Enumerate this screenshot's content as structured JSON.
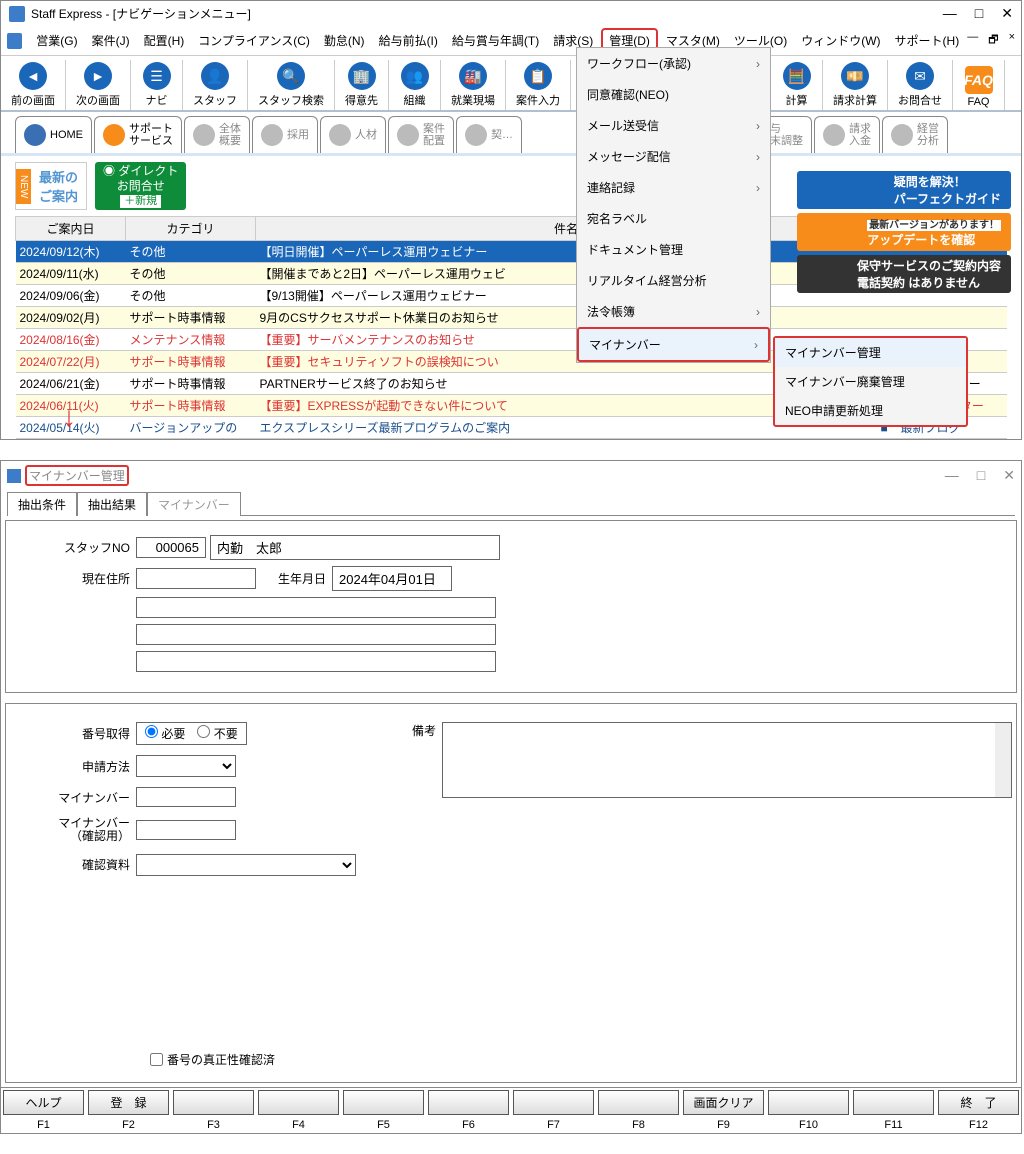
{
  "upper": {
    "title": "Staff Express - [ナビゲーションメニュー]",
    "menus": [
      "営業(G)",
      "案件(J)",
      "配置(H)",
      "コンプライアンス(C)",
      "勤怠(N)",
      "給与前払(I)",
      "給与賞与年調(T)",
      "請求(S)",
      "管理(D)",
      "マスタ(M)",
      "ツール(O)",
      "ウィンドウ(W)",
      "サポート(H)"
    ],
    "toolbar": [
      "前の画面",
      "次の画面",
      "ナビ",
      "スタッフ",
      "スタッフ検索",
      "得意先",
      "組織",
      "就業現場",
      "案件入力",
      "計算",
      "請求計算",
      "お問合せ",
      "FAQ"
    ],
    "dropdown": [
      "ワークフロー(承認)",
      "同意確認(NEO)",
      "メール送受信",
      "メッセージ配信",
      "連絡記録",
      "宛名ラベル",
      "ドキュメント管理",
      "リアルタイム経営分析",
      "法令帳簿",
      "マイナンバー"
    ],
    "submenu": [
      "マイナンバー管理",
      "マイナンバー廃棄管理",
      "NEO申請更新処理"
    ],
    "tabs": [
      {
        "l1": "HOME"
      },
      {
        "l1": "サポート",
        "l2": "サービス"
      },
      {
        "l1": "全体",
        "l2": "概要"
      },
      {
        "l1": "採用"
      },
      {
        "l1": "人材"
      },
      {
        "l1": "案件",
        "l2": "配置"
      },
      {
        "l1": "契…"
      },
      {
        "l1": "給与",
        "l2": "年末調整"
      },
      {
        "l1": "請求",
        "l2": "入金"
      },
      {
        "l1": "経営",
        "l2": "分析"
      }
    ],
    "banner_news": "最新の\nご案内",
    "banner_direct": {
      "t1": "ダイレクト",
      "t2": "お問合せ",
      "t3": "＋新規"
    },
    "sideb": [
      {
        "t1": "疑問を解決！",
        "t2": "パーフェクトガイド"
      },
      {
        "t1": "最新バージョンがあります！",
        "t2": "アップデートを確認"
      },
      {
        "t1": "保守サービスのご契約内容",
        "t2": "電話契約 はありません"
      }
    ],
    "table_head": [
      "ご案内日",
      "カテゴリ",
      "件名",
      "",
      ""
    ],
    "rows": [
      {
        "cls": "row-sel",
        "c": [
          "2024/09/12(木)",
          "その他",
          "【明日開催】ペーパーレス運用ウェビナー",
          "",
          ""
        ]
      },
      {
        "cls": "row-y",
        "c": [
          "2024/09/11(水)",
          "その他",
          "【開催まであと2日】ペーパーレス運用ウェビ",
          "",
          ""
        ]
      },
      {
        "cls": "",
        "c": [
          "2024/09/06(金)",
          "その他",
          "【9/13開催】ペーパーレス運用ウェビナー",
          "",
          ""
        ]
      },
      {
        "cls": "row-y",
        "c": [
          "2024/09/02(月)",
          "サポート時事情報",
          "9月のCSサクセスサポート休業日のお知らせ",
          "",
          ""
        ]
      },
      {
        "cls": "row-r",
        "c": [
          "2024/08/16(金)",
          "メンテナンス情報",
          "【重要】サーバメンテナンスのお知らせ",
          "",
          ""
        ]
      },
      {
        "cls": "row-r row-y",
        "c": [
          "2024/07/22(月)",
          "サポート時事情報",
          "【重要】セキュリティソフトの誤検知につい",
          "",
          ""
        ]
      },
      {
        "cls": "",
        "c": [
          "2024/06/21(金)",
          "サポート時事情報",
          "PARTNERサービス終了のお知らせ",
          "■",
          "PARTNERサー"
        ]
      },
      {
        "cls": "row-r row-y",
        "c": [
          "2024/06/11(火)",
          "サポート時事情報",
          "【重要】EXPRESSが起動できない件について",
          "",
          "ニュースレター"
        ]
      },
      {
        "cls": "row-b",
        "c": [
          "2024/05/14(火)",
          "バージョンアップの",
          "エクスプレスシリーズ最新プログラムのご案内",
          "■",
          "最新プログ"
        ]
      }
    ]
  },
  "lower": {
    "title": "マイナンバー管理",
    "tabs2": [
      "抽出条件",
      "抽出結果",
      "マイナンバー"
    ],
    "staff_no_label": "スタッフNO",
    "staff_no": "000065",
    "staff_name": "内勤　太郎",
    "addr_label": "現在住所",
    "birth_label": "生年月日",
    "birth": "2024年04月01日",
    "num_get_label": "番号取得",
    "radio1": "必要",
    "radio2": "不要",
    "apply_label": "申請方法",
    "myno_label": "マイナンバー",
    "myno2_label": "マイナンバー\n（確認用）",
    "confdoc_label": "確認資料",
    "remark_label": "備考",
    "chk_label": "番号の真正性確認済",
    "fnbtns": [
      "ヘルプ",
      "登　録",
      "",
      "",
      "",
      "",
      "",
      "",
      "画面クリア",
      "",
      "",
      "終　了"
    ],
    "fkeys": [
      "F1",
      "F2",
      "F3",
      "F4",
      "F5",
      "F6",
      "F7",
      "F8",
      "F9",
      "F10",
      "F11",
      "F12"
    ]
  }
}
